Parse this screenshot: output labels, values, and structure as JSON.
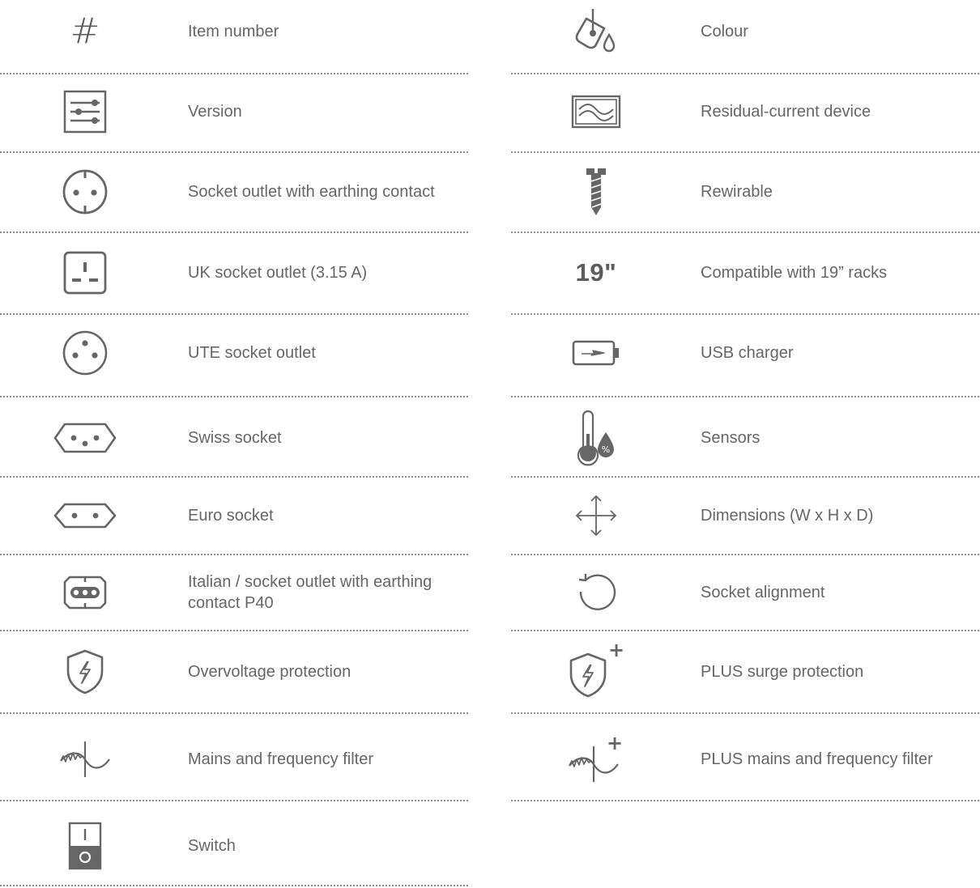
{
  "left": [
    {
      "key": "item-number",
      "label": "Item number",
      "icon": "hash-icon",
      "glyph": "#"
    },
    {
      "key": "version",
      "label": "Version",
      "icon": "sliders-icon"
    },
    {
      "key": "socket-earthing",
      "label": "Socket outlet with earthing contact",
      "icon": "schuko-socket-icon"
    },
    {
      "key": "uk-socket",
      "label": "UK socket outlet (3.15 A)",
      "icon": "uk-socket-icon"
    },
    {
      "key": "ute-socket",
      "label": "UTE socket outlet",
      "icon": "ute-socket-icon"
    },
    {
      "key": "swiss-socket",
      "label": "Swiss socket",
      "icon": "swiss-socket-icon"
    },
    {
      "key": "euro-socket",
      "label": "Euro socket",
      "icon": "euro-socket-icon"
    },
    {
      "key": "italian-socket",
      "label": "Italian / socket outlet with earthing contact P40",
      "icon": "italian-socket-icon"
    },
    {
      "key": "overvoltage",
      "label": "Overvoltage protection",
      "icon": "shield-lightning-icon"
    },
    {
      "key": "mains-filter",
      "label": "Mains and frequency filter",
      "icon": "filter-wave-icon"
    },
    {
      "key": "switch",
      "label": "Switch",
      "icon": "switch-icon"
    }
  ],
  "right": [
    {
      "key": "colour",
      "label": "Colour",
      "icon": "paint-bucket-icon"
    },
    {
      "key": "rcd",
      "label": "Residual-current device",
      "icon": "rcd-wave-icon"
    },
    {
      "key": "rewirable",
      "label": "Rewirable",
      "icon": "screw-icon"
    },
    {
      "key": "rack19",
      "label": "Compatible with 19” racks",
      "icon": "rack-19-icon",
      "glyph": "19\""
    },
    {
      "key": "usb-charger",
      "label": "USB charger",
      "icon": "battery-charging-icon"
    },
    {
      "key": "sensors",
      "label": "Sensors",
      "icon": "thermometer-humidity-icon",
      "glyph": "%"
    },
    {
      "key": "dimensions",
      "label": "Dimensions (W x H x D)",
      "icon": "move-arrows-icon"
    },
    {
      "key": "socket-alignment",
      "label": "Socket alignment",
      "icon": "rotate-icon"
    },
    {
      "key": "plus-surge",
      "label": "PLUS surge protection",
      "icon": "shield-lightning-plus-icon",
      "glyph": "+"
    },
    {
      "key": "plus-mains-filter",
      "label": "PLUS mains and frequency filter",
      "icon": "filter-wave-plus-icon",
      "glyph": "+"
    }
  ],
  "colors": {
    "text": "#666666",
    "icon": "#666666",
    "separator": "#8e8e8e"
  }
}
